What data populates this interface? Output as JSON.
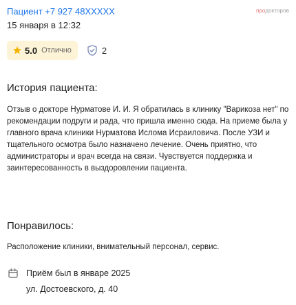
{
  "header": {
    "patient": "Пациент +7 927 48XXXXX",
    "date": "15 января в 12:32",
    "brand_part1": "про",
    "brand_part2": "докторов"
  },
  "ratings": {
    "score": "5.0",
    "score_label": "Отлично",
    "badge_count": "2",
    "star_icon": "star-icon",
    "badge_icon": "shield-check-icon"
  },
  "history": {
    "title": "История пациента:",
    "text": "Отзыв о докторе Нурматове И. И. Я обратилась в клинику \"Варикоза нет\" по рекомендации подруги и рада, что пришла именно сюда. На приеме была у главного врача клиники Нурматова Ислома Исраиловича. После УЗИ и тщательного осмотра было назначено лечение. Очень приятно, что администраторы и врач всегда на связи. Чувствуется поддержка и заинтересованность в выздоровлении пациента."
  },
  "liked": {
    "title": "Понравилось:",
    "text": "Расположение клиники, внимательный персонал, сервис."
  },
  "visit": {
    "icon": "calendar-icon",
    "date": "Приём был в январе 2025",
    "address": "ул. Достоевского, д. 40"
  },
  "colors": {
    "link": "#1a73e8",
    "rating_bg": "#fdf3d6",
    "star": "#f5b301",
    "shield": "#7c8db8",
    "brand_red": "#e57373",
    "brand_gray": "#9e9e9e"
  }
}
